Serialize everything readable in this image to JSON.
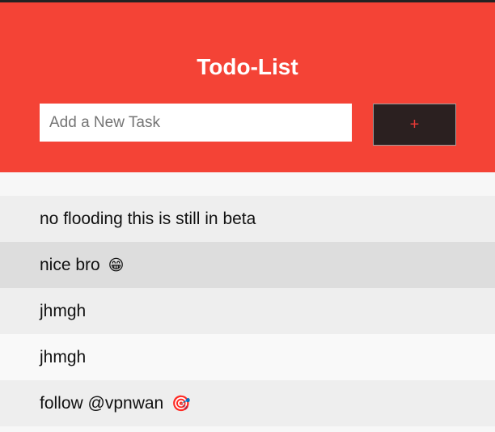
{
  "header": {
    "title": "Todo-List",
    "background_color": "#f44336"
  },
  "new_task": {
    "placeholder": "Add a New Task",
    "value": "",
    "add_button_label": "+"
  },
  "tasks": [
    {
      "text": "no flooding this is still in beta",
      "emoji": ""
    },
    {
      "text": "nice bro",
      "emoji": "😁"
    },
    {
      "text": "jhmgh",
      "emoji": ""
    },
    {
      "text": "jhmgh",
      "emoji": ""
    },
    {
      "text": "follow @vpnwan",
      "emoji": "🎯"
    }
  ]
}
